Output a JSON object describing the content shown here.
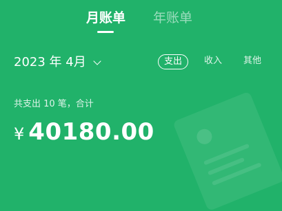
{
  "tabs": {
    "monthly": "月账单",
    "yearly": "年账单"
  },
  "month_picker": {
    "label": "2023 年 4月",
    "icon": "chevron-down-icon"
  },
  "filters": [
    "支出",
    "收入",
    "其他"
  ],
  "summary": {
    "text": "共支出 10 笔，合计",
    "currency": "¥",
    "amount": "40180.00"
  },
  "colors": {
    "background": "#21b26a",
    "text": "#ffffff"
  }
}
